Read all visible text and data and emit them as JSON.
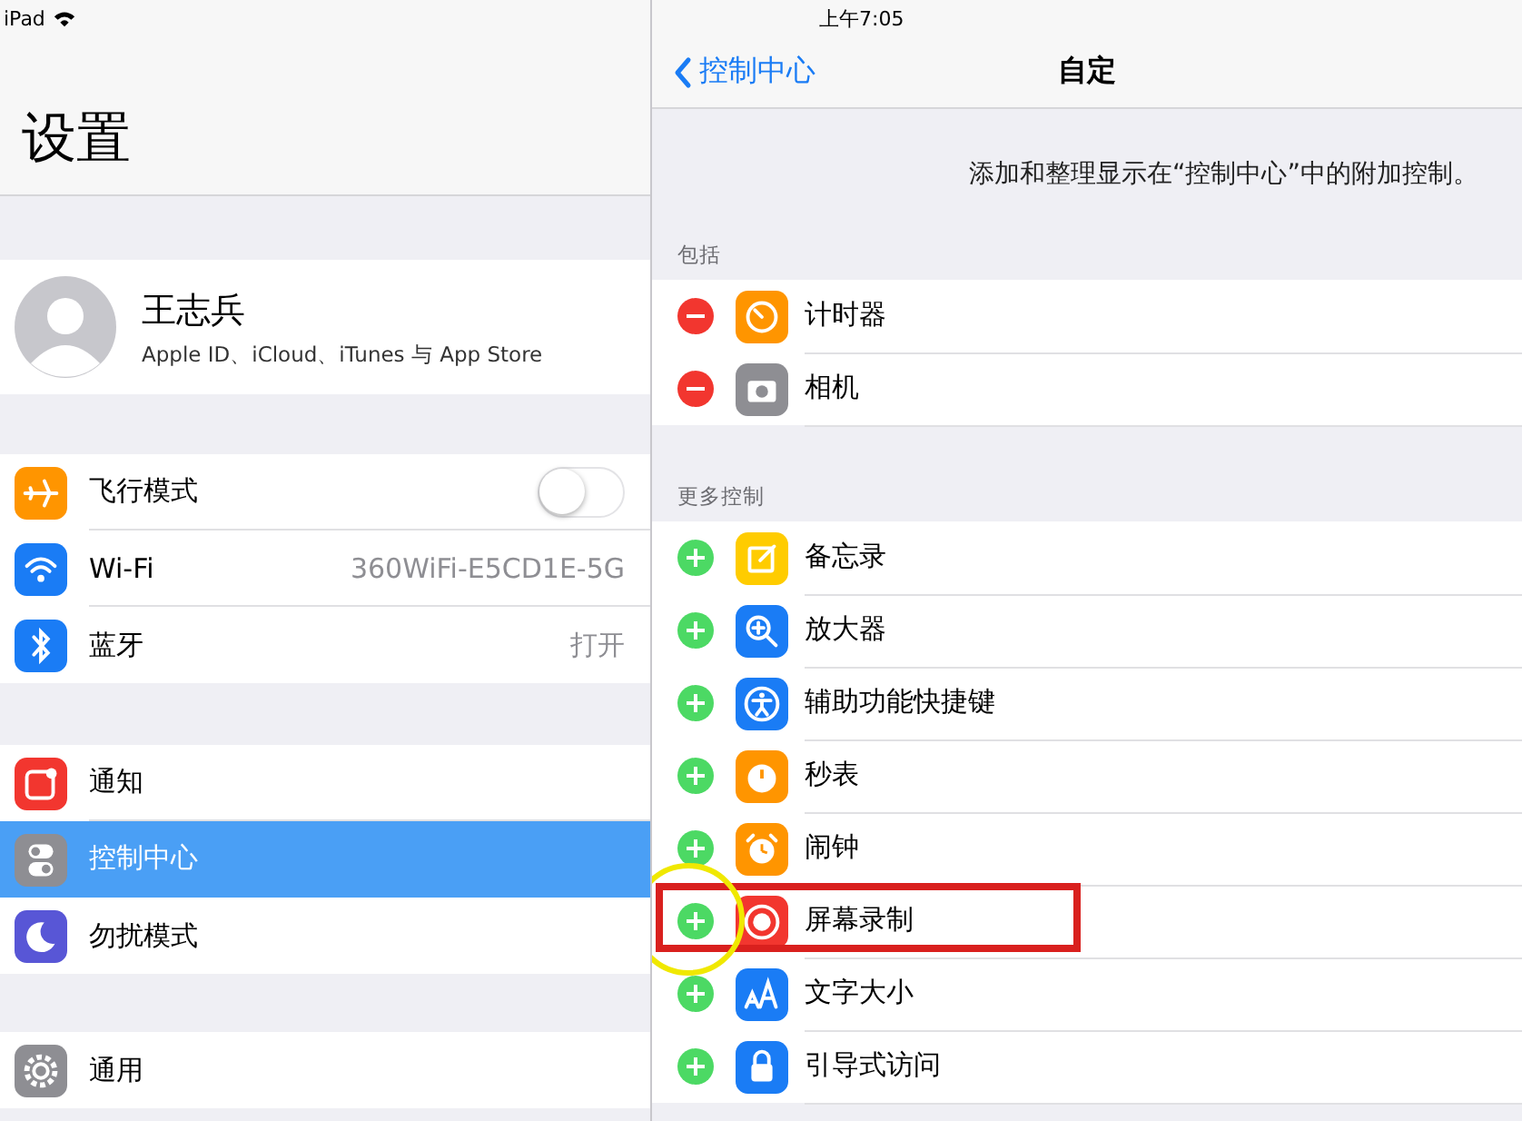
{
  "status_bar": {
    "device": "iPad",
    "time": "上午7:05"
  },
  "sidebar": {
    "title": "设置",
    "profile": {
      "name": "王志兵",
      "subtitle": "Apple ID、iCloud、iTunes 与 App Store"
    },
    "groups": [
      [
        {
          "label": "飞行模式",
          "kind": "toggle",
          "on": false,
          "selected": false,
          "color": "#ff9500"
        },
        {
          "label": "Wi-Fi",
          "kind": "value",
          "value": "360WiFi-E5CD1E-5G",
          "selected": false,
          "color": "#1a7cf5"
        },
        {
          "label": "蓝牙",
          "kind": "value",
          "value": "打开",
          "selected": false,
          "color": "#1a7cf5"
        }
      ],
      [
        {
          "label": "通知",
          "kind": "link",
          "selected": false,
          "color": "#f2362f"
        },
        {
          "label": "控制中心",
          "kind": "link",
          "selected": true,
          "color": "#8e8e93"
        },
        {
          "label": "勿扰模式",
          "kind": "link",
          "selected": false,
          "color": "#5856d6"
        }
      ],
      [
        {
          "label": "通用",
          "kind": "link",
          "selected": false,
          "color": "#8e8e93"
        }
      ]
    ]
  },
  "detail": {
    "back": "控制中心",
    "title": "自定",
    "description": "添加和整理显示在“控制中心”中的附加控制。",
    "sections": [
      {
        "header": "包括",
        "items": [
          {
            "label": "计时器",
            "kind": "remove",
            "color": "#ff9500",
            "highlighted": false
          },
          {
            "label": "相机",
            "kind": "remove",
            "color": "#8e8e93",
            "highlighted": false
          }
        ]
      },
      {
        "header": "更多控制",
        "items": [
          {
            "label": "备忘录",
            "kind": "add",
            "color": "#ffcc00",
            "highlighted": false
          },
          {
            "label": "放大器",
            "kind": "add",
            "color": "#1a7cf5",
            "highlighted": false
          },
          {
            "label": "辅助功能快捷键",
            "kind": "add",
            "color": "#1a7cf5",
            "highlighted": false
          },
          {
            "label": "秒表",
            "kind": "add",
            "color": "#ff9500",
            "highlighted": false
          },
          {
            "label": "闹钟",
            "kind": "add",
            "color": "#ff9500",
            "highlighted": false
          },
          {
            "label": "屏幕录制",
            "kind": "add",
            "color": "#f2362f",
            "highlighted": true
          },
          {
            "label": "文字大小",
            "kind": "add",
            "color": "#1a7cf5",
            "highlighted": false
          },
          {
            "label": "引导式访问",
            "kind": "add",
            "color": "#1a7cf5",
            "highlighted": false
          }
        ]
      }
    ]
  }
}
